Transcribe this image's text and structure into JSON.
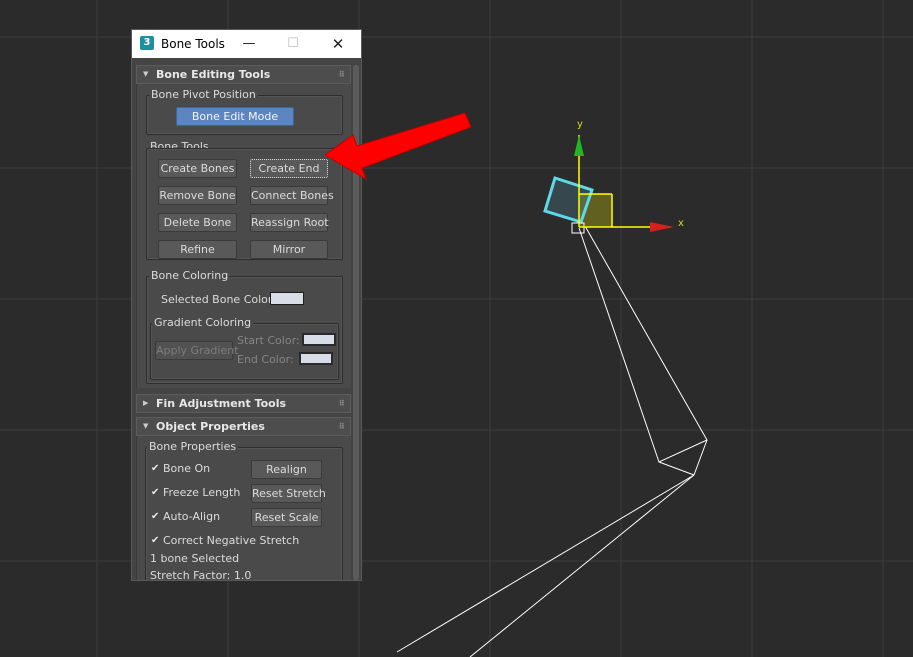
{
  "window": {
    "title": "Bone Tools",
    "app_icon": "3",
    "minimize": "—",
    "maximize": "☐",
    "close": "✕"
  },
  "rollouts": {
    "bone_editing": {
      "title": "Bone Editing Tools",
      "expanded": true,
      "bone_pivot": {
        "label": "Bone Pivot Position",
        "edit_mode": "Bone Edit Mode"
      },
      "bone_tools": {
        "label": "Bone Tools",
        "create_bones": "Create Bones",
        "create_end": "Create End",
        "remove_bone": "Remove Bone",
        "connect_bones": "Connect Bones",
        "delete_bone": "Delete Bone",
        "reassign_root": "Reassign Root",
        "refine": "Refine",
        "mirror": "Mirror"
      },
      "bone_coloring": {
        "label": "Bone Coloring",
        "selected_color_label": "Selected Bone Color:",
        "selected_color": "#d8dde8",
        "gradient": {
          "label": "Gradient Coloring",
          "apply": "Apply Gradient",
          "start_label": "Start Color:",
          "end_label": "End Color:",
          "start_color": "#d8dde8",
          "end_color": "#d8dde8"
        }
      }
    },
    "fin_adjustment": {
      "title": "Fin Adjustment Tools",
      "expanded": false
    },
    "object_properties": {
      "title": "Object Properties",
      "expanded": true,
      "bone_properties": {
        "label": "Bone Properties",
        "bone_on": "Bone On",
        "freeze_length": "Freeze Length",
        "auto_align": "Auto-Align",
        "correct_negative": "Correct Negative Stretch",
        "realign": "Realign",
        "reset_stretch": "Reset Stretch",
        "reset_scale": "Reset Scale",
        "checkmark": "✔",
        "selected_count": "1 bone Selected",
        "stretch_factor": "Stretch Factor: 1.0"
      }
    }
  },
  "viewport": {
    "gizmo_x_label": "x",
    "gizmo_y_label": "y",
    "background": "#2b2b2b",
    "bone_color": "#5fd8ea",
    "wire_color": "#ffffff",
    "annotation_arrow_color": "#ff0000"
  }
}
